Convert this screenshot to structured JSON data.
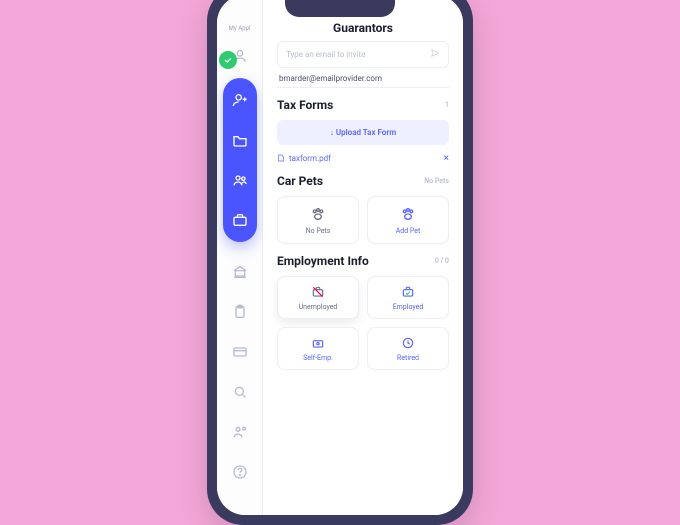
{
  "sidebar": {
    "top_label": "My Appl",
    "rail_items": [
      {
        "name": "person-add-icon"
      },
      {
        "name": "folder-icon"
      },
      {
        "name": "people-icon"
      },
      {
        "name": "briefcase-icon"
      }
    ],
    "rest_items": [
      {
        "name": "bank-icon"
      },
      {
        "name": "clipboard-icon"
      },
      {
        "name": "card-icon"
      },
      {
        "name": "search-user-icon"
      },
      {
        "name": "contacts-icon"
      },
      {
        "name": "help-icon"
      }
    ]
  },
  "guarantors": {
    "title": "Guarantors",
    "invite_placeholder": "Type an email to invite",
    "email": "bmarder@emailprovider.com"
  },
  "tax_forms": {
    "title": "Tax Forms",
    "count": "1",
    "upload_label": "↓ Upload Tax Form",
    "file": "taxform.pdf"
  },
  "car_pets": {
    "title": "Car Pets",
    "aux": "No Pets",
    "cards": [
      {
        "label": "No Pets",
        "accent": false
      },
      {
        "label": "Add Pet",
        "accent": true
      }
    ]
  },
  "employment": {
    "title": "Employment Info",
    "aux": "0 / 0",
    "options": [
      {
        "label": "Unemployed",
        "accent": false,
        "selected": true
      },
      {
        "label": "Employed",
        "accent": true,
        "selected": false
      },
      {
        "label": "Self-Emp.",
        "accent": true,
        "selected": false
      },
      {
        "label": "Retired",
        "accent": true,
        "selected": false
      }
    ]
  }
}
